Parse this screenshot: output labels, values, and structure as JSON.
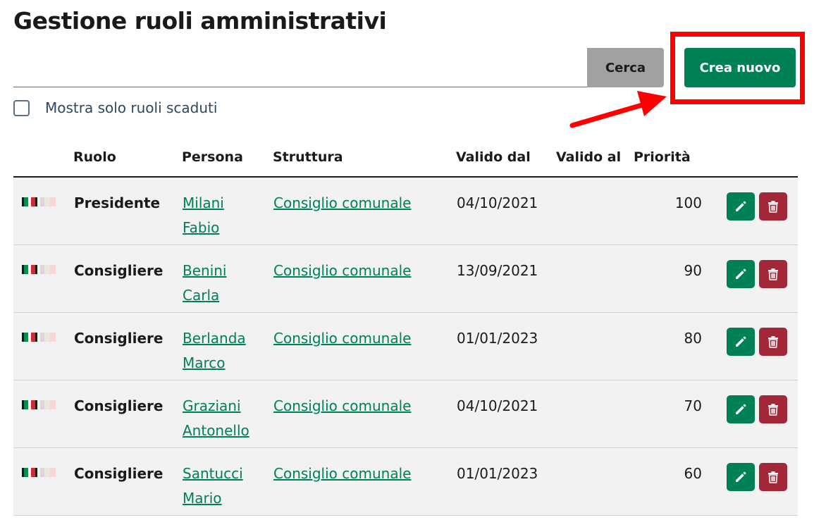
{
  "page": {
    "title": "Gestione ruoli amministrativi"
  },
  "toolbar": {
    "search_value": "",
    "search_button": "Cerca",
    "create_button": "Crea nuovo"
  },
  "filter": {
    "expired_only_label": "Mostra solo ruoli scaduti",
    "checked": false
  },
  "table": {
    "headers": {
      "ruolo": "Ruolo",
      "persona": "Persona",
      "struttura": "Struttura",
      "valido_dal": "Valido dal",
      "valido_al": "Valido al",
      "priorita": "Priorità"
    },
    "rows": [
      {
        "ruolo": "Presidente",
        "persona_cognome": "Milani",
        "persona_nome": "Fabio",
        "struttura": "Consiglio comunale",
        "valido_dal": "04/10/2021",
        "valido_al": "",
        "priorita": "100"
      },
      {
        "ruolo": "Consigliere",
        "persona_cognome": "Benini",
        "persona_nome": "Carla",
        "struttura": "Consiglio comunale",
        "valido_dal": "13/09/2021",
        "valido_al": "",
        "priorita": "90"
      },
      {
        "ruolo": "Consigliere",
        "persona_cognome": "Berlanda",
        "persona_nome": "Marco",
        "struttura": "Consiglio comunale",
        "valido_dal": "01/01/2023",
        "valido_al": "",
        "priorita": "80"
      },
      {
        "ruolo": "Consigliere",
        "persona_cognome": "Graziani",
        "persona_nome": "Antonello",
        "struttura": "Consiglio comunale",
        "valido_dal": "04/10/2021",
        "valido_al": "",
        "priorita": "70"
      },
      {
        "ruolo": "Consigliere",
        "persona_cognome": "Santucci",
        "persona_nome": "Mario",
        "struttura": "Consiglio comunale",
        "valido_dal": "01/01/2023",
        "valido_al": "",
        "priorita": "60"
      }
    ]
  },
  "icons": {
    "edit": "pencil-icon",
    "delete": "trash-icon",
    "flag_active": "flag-italy-icon",
    "flag_inactive": "flag-faded-icon"
  },
  "colors": {
    "primary": "#008055",
    "danger": "#a32639",
    "search_button": "#a1a1a1",
    "annotation": "#ff0000"
  }
}
